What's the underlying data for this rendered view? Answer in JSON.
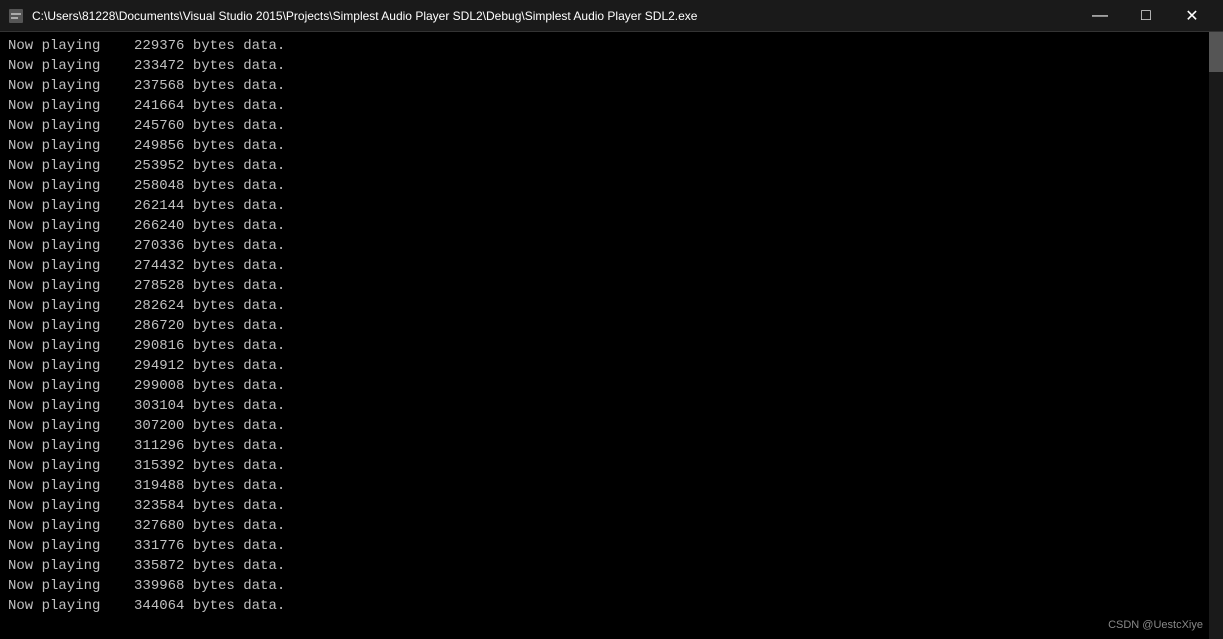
{
  "titleBar": {
    "text": "C:\\Users\\81228\\Documents\\Visual Studio 2015\\Projects\\Simplest Audio Player SDL2\\Debug\\Simplest Audio Player SDL2.exe",
    "icon": "■",
    "minimize": "—",
    "maximize": "□",
    "close": "✕"
  },
  "watermark": "CSDN @UestcXiye",
  "lines": [
    "Now playing    229376 bytes data.",
    "Now playing    233472 bytes data.",
    "Now playing    237568 bytes data.",
    "Now playing    241664 bytes data.",
    "Now playing    245760 bytes data.",
    "Now playing    249856 bytes data.",
    "Now playing    253952 bytes data.",
    "Now playing    258048 bytes data.",
    "Now playing    262144 bytes data.",
    "Now playing    266240 bytes data.",
    "Now playing    270336 bytes data.",
    "Now playing    274432 bytes data.",
    "Now playing    278528 bytes data.",
    "Now playing    282624 bytes data.",
    "Now playing    286720 bytes data.",
    "Now playing    290816 bytes data.",
    "Now playing    294912 bytes data.",
    "Now playing    299008 bytes data.",
    "Now playing    303104 bytes data.",
    "Now playing    307200 bytes data.",
    "Now playing    311296 bytes data.",
    "Now playing    315392 bytes data.",
    "Now playing    319488 bytes data.",
    "Now playing    323584 bytes data.",
    "Now playing    327680 bytes data.",
    "Now playing    331776 bytes data.",
    "Now playing    335872 bytes data.",
    "Now playing    339968 bytes data.",
    "Now playing    344064 bytes data."
  ]
}
